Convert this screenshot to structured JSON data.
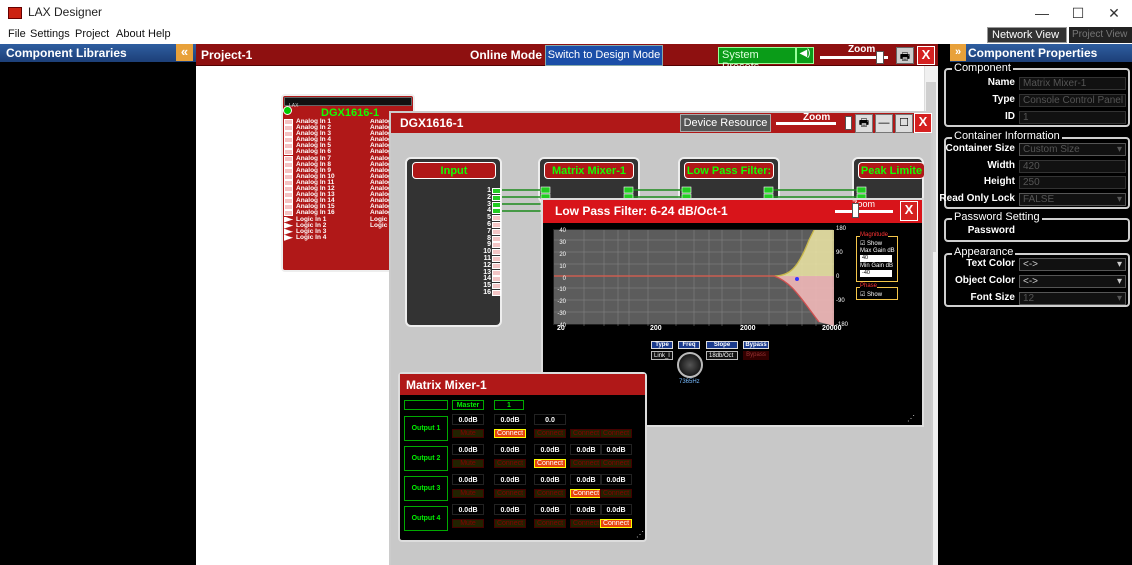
{
  "app": {
    "title": "LAX Designer"
  },
  "window_controls": {
    "minimize": "—",
    "maximize": "☐",
    "close": "✕"
  },
  "menu": [
    "File",
    "Settings",
    "Project",
    "About",
    "Help"
  ],
  "top_tabs": {
    "network": "Network View",
    "project": "Project View"
  },
  "left_panel": {
    "title": "Component Libraries",
    "collapse": "«"
  },
  "project": {
    "title": "Project-1",
    "mode": "Online Mode",
    "switch_button": "Switch to Design Mode",
    "system_presets": "System Presets",
    "speaker": "◀)",
    "zoom_label": "Zoom",
    "print": "🖶",
    "close": "X"
  },
  "mini_device": {
    "title": "DGX1616-1",
    "top_strip": "LAX",
    "inputs": [
      "Analog In 1",
      "Analog In 2",
      "Analog In 3",
      "Analog In 4",
      "Analog In 5",
      "Analog In 6",
      "Analog In 7",
      "Analog In 8",
      "Analog In 9",
      "Analog In 10",
      "Analog In 11",
      "Analog In 12",
      "Analog In 13",
      "Analog In 14",
      "Analog In 15",
      "Analog In 16",
      "Logic In 1",
      "Logic In 2",
      "Logic In 3",
      "Logic In 4"
    ],
    "outputs": [
      "Analog O",
      "Analog O",
      "Analog O",
      "Analog O",
      "Analog O",
      "Analog O",
      "Analog O",
      "Analog O",
      "Analog O",
      "Analog Ou",
      "Analog Ou",
      "Analog Ou",
      "Analog Ou",
      "Analog Ou",
      "Analog Ou",
      "Analog Ou",
      "Logic O",
      "Logic O"
    ]
  },
  "device_window": {
    "title": "DGX1616-1",
    "device_resource": "Device Resource",
    "zoom_label": "Zoom",
    "print": "🖶",
    "minimize": "—",
    "maximize": "☐",
    "close": "X",
    "blocks": {
      "input": "Input",
      "matrix": "Matrix Mixer-1",
      "lpf": "Low Pass Filter:",
      "peak": "Peak Limite"
    },
    "pin_numbers": [
      "1",
      "2",
      "3",
      "4",
      "5",
      "6",
      "7",
      "8",
      "9",
      "10",
      "11",
      "12",
      "13",
      "14",
      "15",
      "16"
    ]
  },
  "lpf_window": {
    "title": "Low Pass Filter: 6-24 dB/Oct-1",
    "zoom_label": "Zoom",
    "close": "X",
    "y_left_ticks": [
      "40",
      "30",
      "20",
      "10",
      "0",
      "-10",
      "-20",
      "-30",
      "-40"
    ],
    "y_right_ticks": [
      "180",
      "90",
      "0",
      "-90",
      "-180"
    ],
    "x_ticks": [
      "20",
      "200",
      "2000",
      "20000"
    ],
    "magnitude": {
      "title": "Magnitude",
      "show": "Show",
      "max_label": "Max Gain dB",
      "max_val": "40",
      "min_label": "Min Gain dB",
      "min_val": "-40"
    },
    "phase": {
      "title": "Phase",
      "show": "Show"
    },
    "controls": {
      "type_label": "Type",
      "type_val": "Link_l",
      "freq_label": "Freq",
      "slope_label": "Slope",
      "slope_val": "18db/Oct",
      "bypass_label": "Bypass",
      "bypass_val": "Bypass",
      "freq_val": "7365Hz"
    }
  },
  "matrix_window": {
    "title": "Matrix Mixer-1",
    "col_headers": [
      "Master",
      "1"
    ],
    "rows": [
      {
        "label": "Output 1",
        "gains": [
          "0.0dB",
          "0.0dB",
          "0.0"
        ],
        "connects": [
          "Mute",
          "Connect",
          "Connect",
          "Connect",
          "Connect"
        ],
        "active": 1
      },
      {
        "label": "Output 2",
        "gains": [
          "0.0dB",
          "0.0dB",
          "0.0dB",
          "0.0dB",
          "0.0dB"
        ],
        "connects": [
          "Mute",
          "Connect",
          "Connect",
          "Connect",
          "Connect"
        ],
        "active": 2
      },
      {
        "label": "Output 3",
        "gains": [
          "0.0dB",
          "0.0dB",
          "0.0dB",
          "0.0dB",
          "0.0dB"
        ],
        "connects": [
          "Mute",
          "Connect",
          "Connect",
          "Connect",
          "Connect"
        ],
        "active": 3
      },
      {
        "label": "Output 4",
        "gains": [
          "0.0dB",
          "0.0dB",
          "0.0dB",
          "0.0dB",
          "0.0dB"
        ],
        "connects": [
          "Mute",
          "Connect",
          "Connect",
          "Connect",
          "Connect"
        ],
        "active": 4
      }
    ]
  },
  "right_panel": {
    "title": "Component Properties",
    "expand": "»",
    "component": {
      "group": "Component",
      "name_label": "Name",
      "name_val": "Matrix Mixer-1",
      "type_label": "Type",
      "type_val": "Console Control Panel",
      "id_label": "ID",
      "id_val": "1"
    },
    "container": {
      "group": "Container Information",
      "size_label": "Container Size",
      "size_val": "Custom Size",
      "width_label": "Width",
      "width_val": "420",
      "height_label": "Height",
      "height_val": "250",
      "lock_label": "Read Only Lock",
      "lock_val": "FALSE"
    },
    "password": {
      "group": "Password Setting",
      "label": "Password"
    },
    "appearance": {
      "group": "Appearance",
      "text_color_label": "Text Color",
      "text_color_val": "<->",
      "object_color_label": "Object Color",
      "object_color_val": "<->",
      "font_size_label": "Font Size",
      "font_size_val": "12"
    }
  },
  "colors": {
    "accent_red": "#b01818",
    "panel_blue": "#2f5ea0",
    "preset_green": "#0a9c18"
  }
}
